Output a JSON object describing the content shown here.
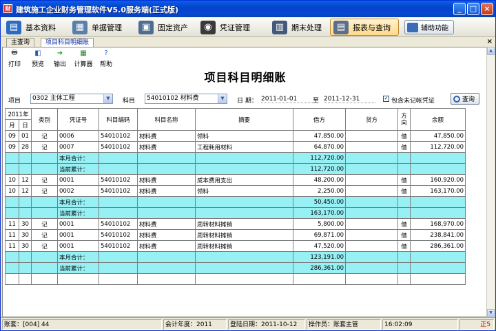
{
  "window": {
    "title": "建筑施工企业财务管理软件V5.0服务端(正式版)",
    "min": "_",
    "max": "□",
    "close": "×"
  },
  "modules": [
    {
      "label": "基本资料",
      "color": "#2a6bc4",
      "glyph": "▤"
    },
    {
      "label": "单据管理",
      "color": "#5a7fa8",
      "glyph": "▦"
    },
    {
      "label": "固定资产",
      "color": "#4d6d92",
      "glyph": "▣"
    },
    {
      "label": "凭证管理",
      "color": "#3a3a3a",
      "glyph": "◉"
    },
    {
      "label": "期末处理",
      "color": "#445a7a",
      "glyph": "▥"
    },
    {
      "label": "报表与查询",
      "color": "#5c6e8a",
      "glyph": "▤"
    }
  ],
  "assist_label": "辅助功能",
  "tabs": [
    "主查询",
    "项目科目明细账"
  ],
  "report_tools": [
    {
      "label": "打印",
      "glyph": "🖶",
      "color": "#555"
    },
    {
      "label": "预览",
      "glyph": "◧",
      "color": "#2a58b0"
    },
    {
      "label": "输出",
      "glyph": "➜",
      "color": "#2a9a2a"
    },
    {
      "label": "计算器",
      "glyph": "▦",
      "color": "#2a7a2a"
    },
    {
      "label": "帮助",
      "glyph": "?",
      "color": "#1f5ec8"
    }
  ],
  "report_title": "项目科目明细账",
  "filter": {
    "project_label": "项目",
    "project_value": "0302 主体工程",
    "subject_label": "科目",
    "subject_value": "54010102 材料费",
    "date_label": "日  期：",
    "date_from": "2011-01-01",
    "to_label": "至",
    "date_to": "2011-12-31",
    "include_label": "包含未记帐凭证",
    "include_checked": true,
    "query_label": "查询"
  },
  "table": {
    "year": "2011年",
    "month": "月",
    "day": "日",
    "headers": [
      "类别",
      "凭证号",
      "科目编码",
      "科目名称",
      "摘要",
      "借方",
      "贷方",
      "方向",
      "余额"
    ],
    "rows": [
      {
        "m": "09",
        "d": "01",
        "cat": "记",
        "vno": "0006",
        "code": "54010102",
        "name": "材料费",
        "desc": "领料",
        "debit": "47,850.00",
        "credit": "",
        "dir": "借",
        "bal": "47,850.00",
        "cyan": false
      },
      {
        "m": "09",
        "d": "28",
        "cat": "记",
        "vno": "0007",
        "code": "54010102",
        "name": "材料费",
        "desc": "工程耗用材料",
        "debit": "64,870.00",
        "credit": "",
        "dir": "借",
        "bal": "112,720.00",
        "cyan": false
      },
      {
        "m": "",
        "d": "",
        "cat": "",
        "vno": "本月合计：",
        "code": "",
        "name": "",
        "desc": "",
        "debit": "112,720.00",
        "credit": "",
        "dir": "",
        "bal": "",
        "cyan": true
      },
      {
        "m": "",
        "d": "",
        "cat": "",
        "vno": "当前累计：",
        "code": "",
        "name": "",
        "desc": "",
        "debit": "112,720.00",
        "credit": "",
        "dir": "",
        "bal": "",
        "cyan": true
      },
      {
        "m": "10",
        "d": "12",
        "cat": "记",
        "vno": "0001",
        "code": "54010102",
        "name": "材料费",
        "desc": "成本费用支出",
        "debit": "48,200.00",
        "credit": "",
        "dir": "借",
        "bal": "160,920.00",
        "cyan": false
      },
      {
        "m": "10",
        "d": "12",
        "cat": "记",
        "vno": "0002",
        "code": "54010102",
        "name": "材料费",
        "desc": "领料",
        "debit": "2,250.00",
        "credit": "",
        "dir": "借",
        "bal": "163,170.00",
        "cyan": false
      },
      {
        "m": "",
        "d": "",
        "cat": "",
        "vno": "本月合计：",
        "code": "",
        "name": "",
        "desc": "",
        "debit": "50,450.00",
        "credit": "",
        "dir": "",
        "bal": "",
        "cyan": true
      },
      {
        "m": "",
        "d": "",
        "cat": "",
        "vno": "当前累计：",
        "code": "",
        "name": "",
        "desc": "",
        "debit": "163,170.00",
        "credit": "",
        "dir": "",
        "bal": "",
        "cyan": true
      },
      {
        "m": "11",
        "d": "30",
        "cat": "记",
        "vno": "0001",
        "code": "54010102",
        "name": "材料费",
        "desc": "周转材料摊销",
        "debit": "5,800.00",
        "credit": "",
        "dir": "借",
        "bal": "168,970.00",
        "cyan": false
      },
      {
        "m": "11",
        "d": "30",
        "cat": "记",
        "vno": "0001",
        "code": "54010102",
        "name": "材料费",
        "desc": "周转材料摊销",
        "debit": "69,871.00",
        "credit": "",
        "dir": "借",
        "bal": "238,841.00",
        "cyan": false
      },
      {
        "m": "11",
        "d": "30",
        "cat": "记",
        "vno": "0001",
        "code": "54010102",
        "name": "材料费",
        "desc": "周转材料摊销",
        "debit": "47,520.00",
        "credit": "",
        "dir": "借",
        "bal": "286,361.00",
        "cyan": false
      },
      {
        "m": "",
        "d": "",
        "cat": "",
        "vno": "本月合计：",
        "code": "",
        "name": "",
        "desc": "",
        "debit": "123,191.00",
        "credit": "",
        "dir": "",
        "bal": "",
        "cyan": true
      },
      {
        "m": "",
        "d": "",
        "cat": "",
        "vno": "当前累计：",
        "code": "",
        "name": "",
        "desc": "",
        "debit": "286,361.00",
        "credit": "",
        "dir": "",
        "bal": "",
        "cyan": true
      },
      {
        "m": "",
        "d": "",
        "cat": "",
        "vno": "",
        "code": "",
        "name": "",
        "desc": "",
        "debit": "",
        "credit": "",
        "dir": "",
        "bal": "",
        "cyan": false
      }
    ]
  },
  "status": {
    "account": "账套：[004] 44",
    "year": "会计年度：2011",
    "login": "登陆日期：2011-10-12",
    "operator": "操作员：账套主管",
    "time": "16:02:09",
    "indicator": "正5"
  }
}
